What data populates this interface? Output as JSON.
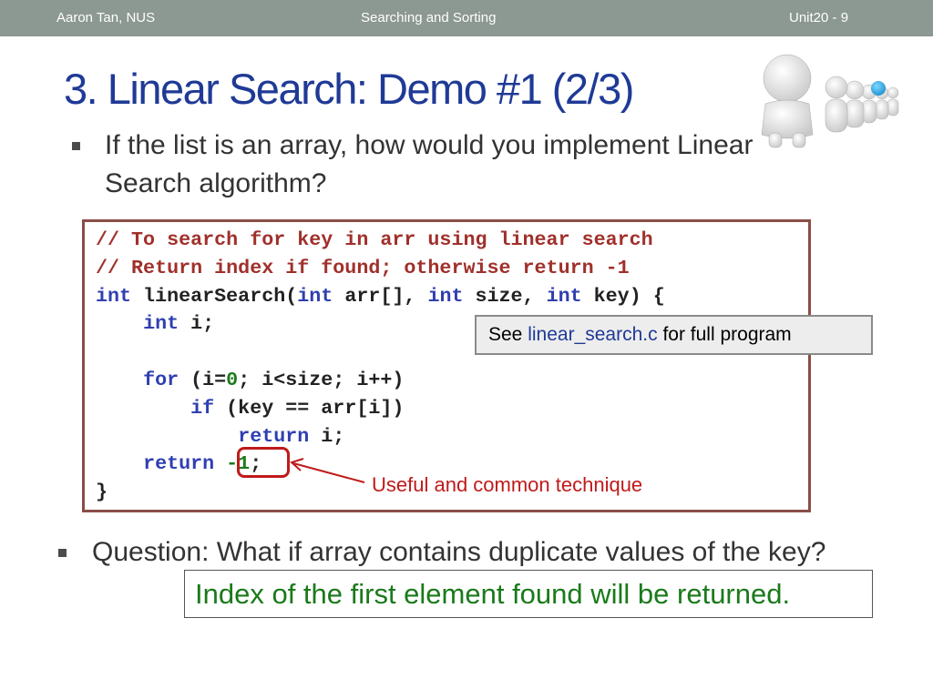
{
  "header": {
    "author": "Aaron Tan,  NUS",
    "topic": "Searching and Sorting",
    "unit": "Unit20 - 9"
  },
  "slide": {
    "title": "3. Linear Search: Demo #1 (2/3)",
    "bullet1": "If the list is an array, how would you implement Linear Search algorithm?",
    "bullet2": "Question: What if array contains duplicate values of the key?"
  },
  "code": {
    "lines": [
      [
        {
          "t": "// To search for key in arr using linear search",
          "c": "cm"
        }
      ],
      [
        {
          "t": "// Return index if found; otherwise return -1",
          "c": "cm"
        }
      ],
      [
        {
          "t": "int",
          "c": "kw"
        },
        {
          "t": " linearSearch("
        },
        {
          "t": "int",
          "c": "kw"
        },
        {
          "t": " arr[], "
        },
        {
          "t": "int",
          "c": "kw"
        },
        {
          "t": " size, "
        },
        {
          "t": "int",
          "c": "kw"
        },
        {
          "t": " key) {"
        }
      ],
      [
        {
          "t": "    "
        },
        {
          "t": "int",
          "c": "kw"
        },
        {
          "t": " i;"
        }
      ],
      [
        {
          "t": ""
        }
      ],
      [
        {
          "t": "    "
        },
        {
          "t": "for",
          "c": "kw"
        },
        {
          "t": " (i="
        },
        {
          "t": "0",
          "c": "num"
        },
        {
          "t": "; i<size; i++)"
        }
      ],
      [
        {
          "t": "        "
        },
        {
          "t": "if",
          "c": "kw"
        },
        {
          "t": " (key == arr[i])"
        }
      ],
      [
        {
          "t": "            "
        },
        {
          "t": "return",
          "c": "kw"
        },
        {
          "t": " i;"
        }
      ],
      [
        {
          "t": "    "
        },
        {
          "t": "return",
          "c": "kw"
        },
        {
          "t": " "
        },
        {
          "t": "-1",
          "c": "num"
        },
        {
          "t": ";"
        }
      ],
      [
        {
          "t": "}"
        }
      ]
    ]
  },
  "callouts": {
    "see_prefix": "See ",
    "see_file": "linear_search.c",
    "see_suffix": " for full program",
    "technique": "Useful and common technique",
    "answer": "Index of the first element found will be returned."
  },
  "colors": {
    "title": "#1f3a96",
    "comment": "#a0302b",
    "keyword": "#2f3fb0",
    "number": "#1f7a1f",
    "note": "#c01a1a",
    "answer": "#1a7a1a",
    "header_bg": "#8c9892"
  },
  "icons": {
    "decoration": "people-queue-icon"
  }
}
